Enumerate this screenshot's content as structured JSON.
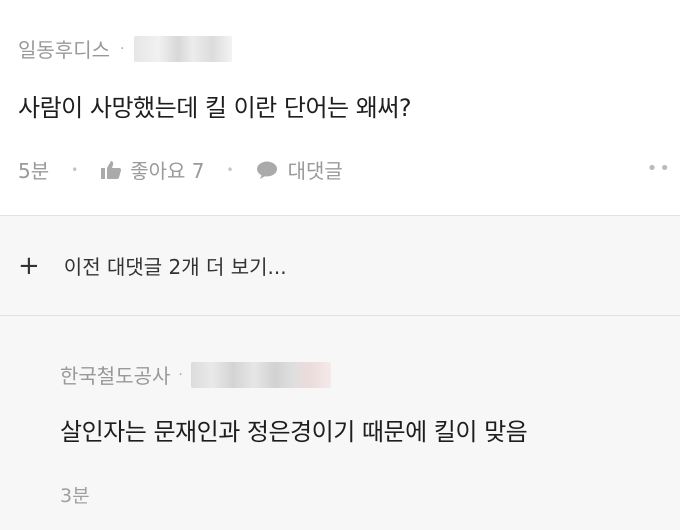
{
  "comment": {
    "author": "일동후디스",
    "separator": "·",
    "text": "사람이 사망했는데 킬 이란 단어는 왜써?",
    "time": "5분",
    "like_label": "좋아요 7",
    "reply_label": "대댓글",
    "more_icon": "more-dots-icon"
  },
  "more_replies": {
    "icon": "plus-icon",
    "label": "이전 대댓글 2개 더 보기..."
  },
  "reply": {
    "author": "한국철도공사",
    "separator": "·",
    "text": "살인자는 문재인과 정은경이기 때문에 킬이 맞음",
    "time": "3분"
  },
  "colors": {
    "meta_gray": "#999999",
    "text_dark": "#1e1e1e",
    "background": "#f7f7f7",
    "card": "#ffffff"
  }
}
